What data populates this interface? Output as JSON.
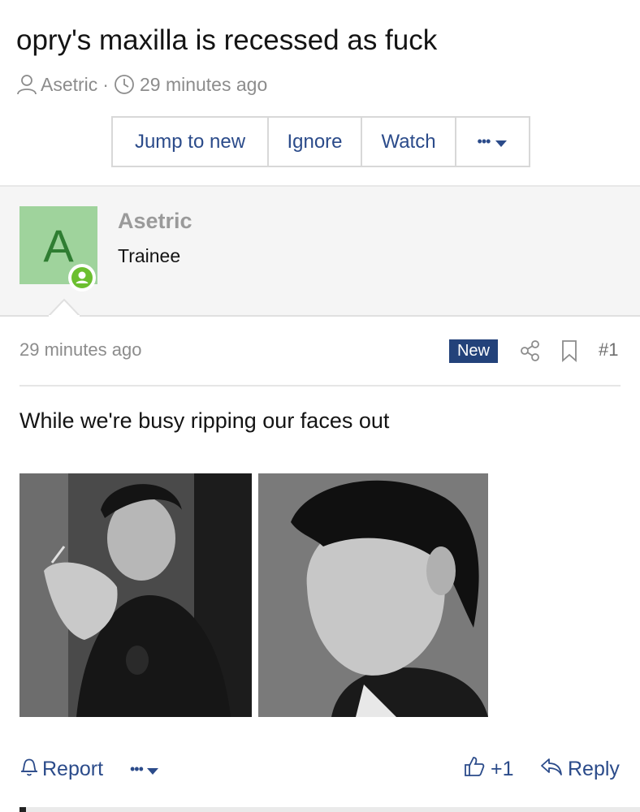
{
  "thread": {
    "title": "opry's maxilla is recessed as fuck",
    "author": "Asetric",
    "separator": "·",
    "time": "29 minutes ago"
  },
  "actions": {
    "jump_label": "Jump to new",
    "ignore_label": "Ignore",
    "watch_label": "Watch",
    "more_label": "•••"
  },
  "user": {
    "avatar_letter": "A",
    "name": "Asetric",
    "title": "Trainee",
    "avatar_color": "#9fd39c",
    "online_color": "#6cbf2f"
  },
  "post": {
    "date": "29 minutes ago",
    "new_badge": "New",
    "number": "#1",
    "text": "While we're busy ripping our faces out",
    "images": [
      {
        "icon": "photo-man-holding-cigarette"
      },
      {
        "icon": "photo-man-profile"
      }
    ]
  },
  "footer": {
    "report_label": "Report",
    "more_label": "•••",
    "reaction_count": "+1",
    "reply_label": "Reply"
  },
  "colors": {
    "link": "#2b4b8a",
    "badge_bg": "#23427a",
    "muted": "#8c8c8c"
  }
}
